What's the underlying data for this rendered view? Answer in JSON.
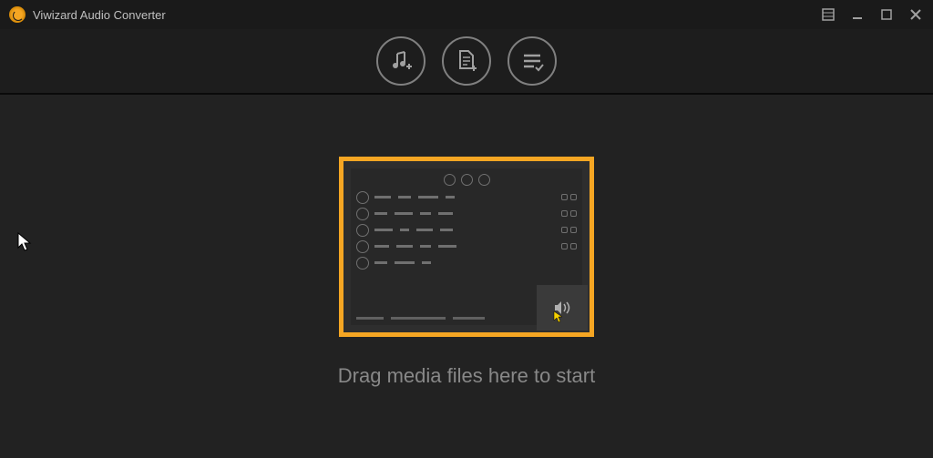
{
  "app": {
    "title": "Viwizard Audio Converter"
  },
  "toolbar": {
    "add_music_label": "Add Music",
    "add_file_label": "Add File",
    "list_label": "Output List"
  },
  "main": {
    "drop_text": "Drag media files here to start"
  },
  "colors": {
    "accent": "#f5a623",
    "bg": "#1a1a1a",
    "panel": "#222222"
  }
}
